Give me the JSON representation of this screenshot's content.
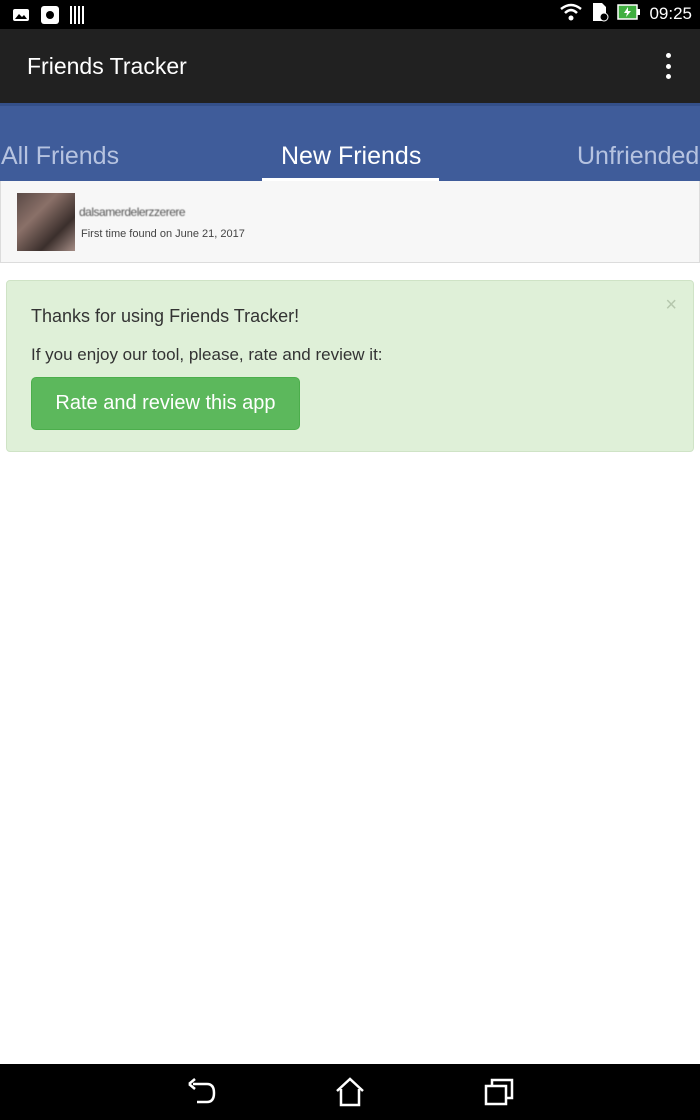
{
  "status_bar": {
    "time": "09:25",
    "icons": [
      "image-icon",
      "app-icon",
      "barcode-icon",
      "wifi-icon",
      "sim-icon",
      "battery-charging-icon"
    ]
  },
  "app_bar": {
    "title": "Friends Tracker",
    "menu_icon": "overflow-menu-icon"
  },
  "tabs": {
    "items": [
      {
        "label": "All Friends"
      },
      {
        "label": "New Friends",
        "active": true
      },
      {
        "label": "Unfriended"
      }
    ]
  },
  "friend": {
    "name": "dalsamerdelerzzerere",
    "found_text": "First time found on June 21, 2017"
  },
  "alert": {
    "line1": "Thanks for using Friends Tracker!",
    "line2": "If you enjoy our tool, please, rate and review it:",
    "button_label": "Rate and review this app",
    "close_symbol": "×"
  },
  "nav_bar": {
    "icons": [
      "back-icon",
      "home-icon",
      "recent-apps-icon"
    ]
  },
  "colors": {
    "tab_bar": "#3f5c9a",
    "app_bar": "#212121",
    "alert_bg": "#dff0d8",
    "button": "#5cb85c"
  }
}
